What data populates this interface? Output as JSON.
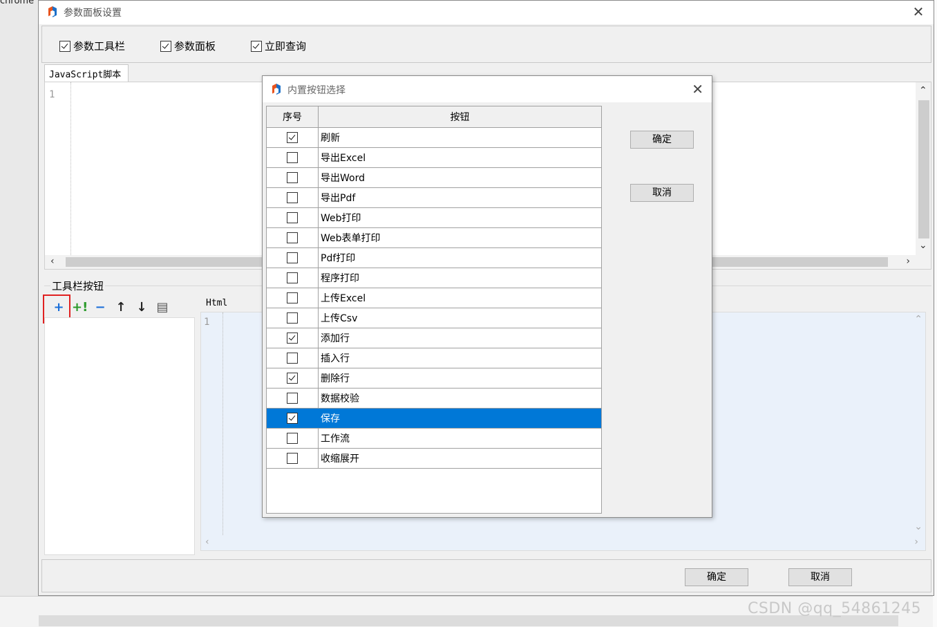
{
  "background": {
    "chrome_label": "chrome"
  },
  "main_dialog": {
    "title": "参数面板设置",
    "options": [
      {
        "label": "参数工具栏",
        "checked": true
      },
      {
        "label": "参数面板",
        "checked": true
      },
      {
        "label": "立即查询",
        "checked": true
      }
    ],
    "js_tab": "JavaScript脚本",
    "js_line": "1",
    "toolbar_group_label": "工具栏按钮",
    "html_label": "Html",
    "html_line": "1",
    "ok_label": "确定",
    "cancel_label": "取消"
  },
  "modal": {
    "title": "内置按钮选择",
    "header": {
      "index": "序号",
      "button": "按钮"
    },
    "rows": [
      {
        "label": "刷新",
        "checked": true
      },
      {
        "label": "导出Excel",
        "checked": false
      },
      {
        "label": "导出Word",
        "checked": false
      },
      {
        "label": "导出Pdf",
        "checked": false
      },
      {
        "label": "Web打印",
        "checked": false
      },
      {
        "label": "Web表单打印",
        "checked": false
      },
      {
        "label": "Pdf打印",
        "checked": false
      },
      {
        "label": "程序打印",
        "checked": false
      },
      {
        "label": "上传Excel",
        "checked": false
      },
      {
        "label": "上传Csv",
        "checked": false
      },
      {
        "label": "添加行",
        "checked": true
      },
      {
        "label": "插入行",
        "checked": false
      },
      {
        "label": "删除行",
        "checked": true
      },
      {
        "label": "数据校验",
        "checked": false
      },
      {
        "label": "保存",
        "checked": true,
        "selected": true
      },
      {
        "label": "工作流",
        "checked": false
      },
      {
        "label": "收缩展开",
        "checked": false
      }
    ],
    "ok_label": "确定",
    "cancel_label": "取消"
  },
  "watermark": "CSDN @qq_54861245",
  "colors": {
    "selection": "#0078d7",
    "highlight_box": "#e02020"
  }
}
